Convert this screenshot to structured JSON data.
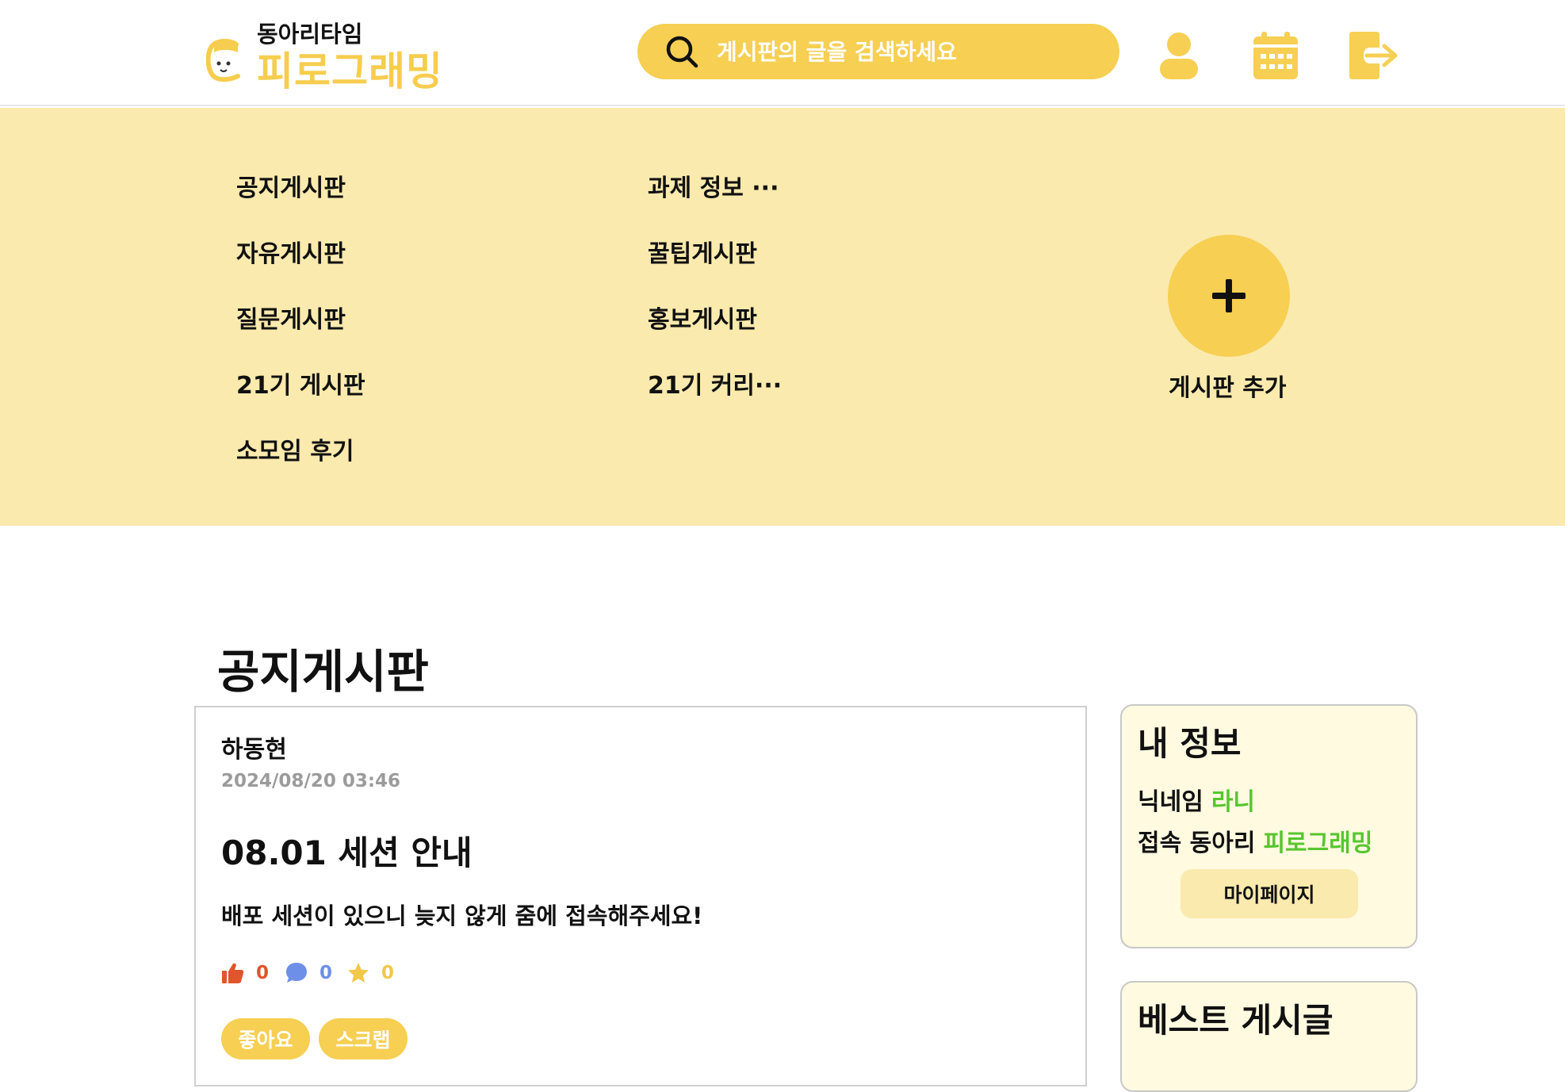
{
  "header": {
    "logo_sub": "동아리타임",
    "logo_main": "피로그래밍",
    "search_placeholder": "게시판의 글을 검색하세요"
  },
  "boards": {
    "left": [
      "공지게시판",
      "자유게시판",
      "질문게시판",
      "21기 게시판",
      "소모임 후기"
    ],
    "right": [
      "과제 정보 ···",
      "꿀팁게시판",
      "홍보게시판",
      "21기 커리···"
    ],
    "add_label": "게시판 추가"
  },
  "main": {
    "page_title": "공지게시판"
  },
  "post": {
    "author": "하동현",
    "date": "2024/08/20 03:46",
    "title": "08.01 세션 안내",
    "body": "배포 세션이 있으니 늦지 않게 줌에 접속해주세요!",
    "likes": "0",
    "comments": "0",
    "scraps": "0",
    "like_button": "좋아요",
    "scrap_button": "스크랩"
  },
  "my_info": {
    "title": "내 정보",
    "nickname_label": "닉네임",
    "nickname": "라니",
    "club_label": "접속 동아리",
    "club": "피로그래밍",
    "mypage_button": "마이페이지"
  },
  "best": {
    "title": "베스트 게시글"
  },
  "colors": {
    "accent": "#f6cf53",
    "menu_bg": "#fbeaad",
    "like": "#e0552b",
    "comment": "#6d8fe8",
    "scrap": "#f2c84b",
    "green": "#56c62f"
  }
}
